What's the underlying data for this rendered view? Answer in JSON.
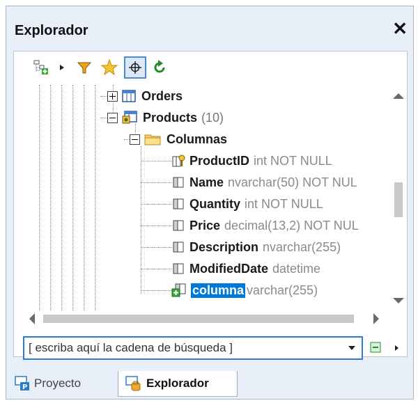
{
  "window": {
    "title": "Explorador",
    "close_glyph": "✕"
  },
  "toolbar": {
    "buttons": [
      {
        "icon": "add-object-icon"
      },
      {
        "icon": "expand-arrow-icon"
      },
      {
        "icon": "filter-icon"
      },
      {
        "icon": "favorites-star-icon"
      },
      {
        "icon": "locate-crosshair-icon",
        "active": true
      },
      {
        "icon": "refresh-icon"
      }
    ]
  },
  "tree": {
    "orders": {
      "name": "Orders"
    },
    "products": {
      "name": "Products",
      "count": "(10)"
    },
    "columns_folder": {
      "name": "Columnas"
    },
    "columns": [
      {
        "name": "ProductID",
        "type": "int NOT NULL",
        "icon": "primary-key-column-icon"
      },
      {
        "name": "Name",
        "type": "nvarchar(50) NOT NUL",
        "icon": "column-icon"
      },
      {
        "name": "Quantity",
        "type": "int NOT NULL",
        "icon": "column-icon"
      },
      {
        "name": "Price",
        "type": "decimal(13,2) NOT NUL",
        "icon": "column-icon"
      },
      {
        "name": "Description",
        "type": "nvarchar(255)",
        "icon": "column-icon"
      },
      {
        "name": "ModifiedDate",
        "type": "datetime",
        "icon": "column-icon"
      },
      {
        "name": "columna",
        "type": "varchar(255)",
        "icon": "new-column-icon",
        "selected": true
      }
    ]
  },
  "search": {
    "placeholder": "[ escriba aquí la cadena de búsqueda ]"
  },
  "tabs": [
    {
      "label": "Proyecto",
      "active": false
    },
    {
      "label": "Explorador",
      "active": true
    }
  ],
  "colors": {
    "accent": "#0078d7",
    "panel_bg": "#e8eff9",
    "border": "#2d7ad6"
  }
}
